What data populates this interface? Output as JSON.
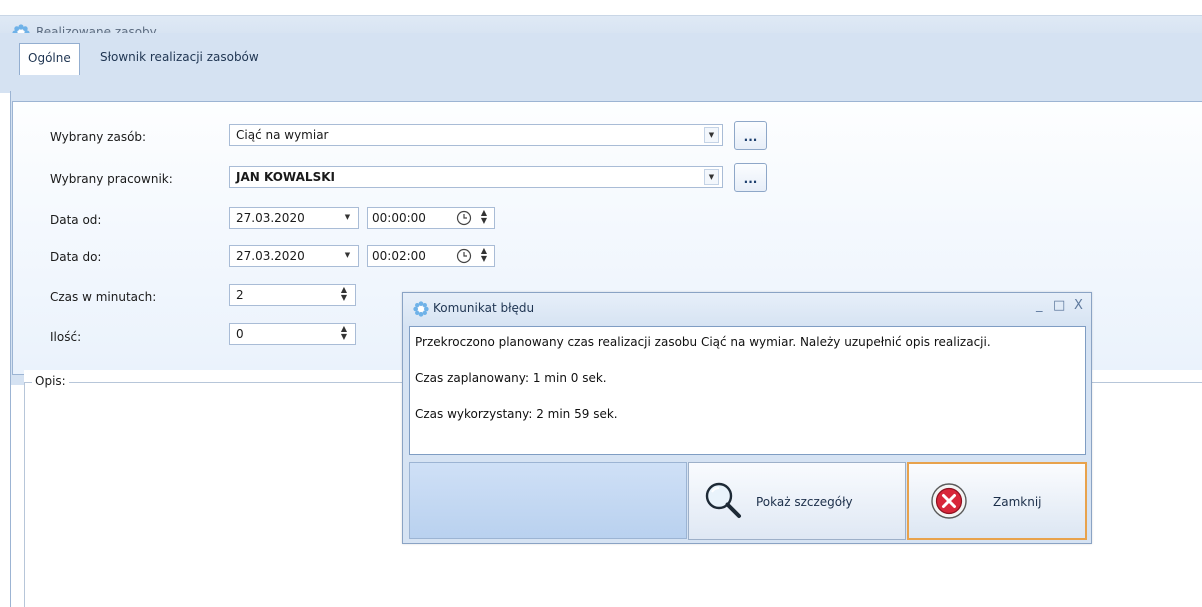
{
  "window": {
    "title": "Realizowane zasoby"
  },
  "tabs": [
    {
      "label": "Ogólne",
      "active": true
    },
    {
      "label": "Słownik realizacji zasobów",
      "active": false
    }
  ],
  "form": {
    "resource_label": "Wybrany zasób:",
    "resource_value": "Ciąć na wymiar",
    "worker_label": "Wybrany pracownik:",
    "worker_value": "JAN KOWALSKI",
    "dots_label": "...",
    "date_from_label": "Data od:",
    "date_from_value": "27.03.2020",
    "time_from_value": "00:00:00",
    "date_to_label": "Data do:",
    "date_to_value": "27.03.2020",
    "time_to_value": "00:02:00",
    "minutes_label": "Czas w minutach:",
    "minutes_value": "2",
    "qty_label": "Ilość:",
    "qty_value": "0",
    "description_label": "Opis:"
  },
  "dialog": {
    "title": "Komunikat błędu",
    "controls": [
      "_",
      "□",
      "X"
    ],
    "message_lines": [
      "Przekroczono planowany czas realizacji zasobu Ciąć na wymiar. Należy uzupełnić opis realizacji.",
      "Czas zaplanowany: 1 min 0 sek.",
      "Czas wykorzystany: 2 min 59 sek."
    ],
    "details_button": "Pokaż szczegóły",
    "close_button": "Zamknij"
  },
  "colors": {
    "accent_blue": "#d5e2f2",
    "focus_orange": "#e8a24c",
    "error_red": "#d8273a"
  }
}
